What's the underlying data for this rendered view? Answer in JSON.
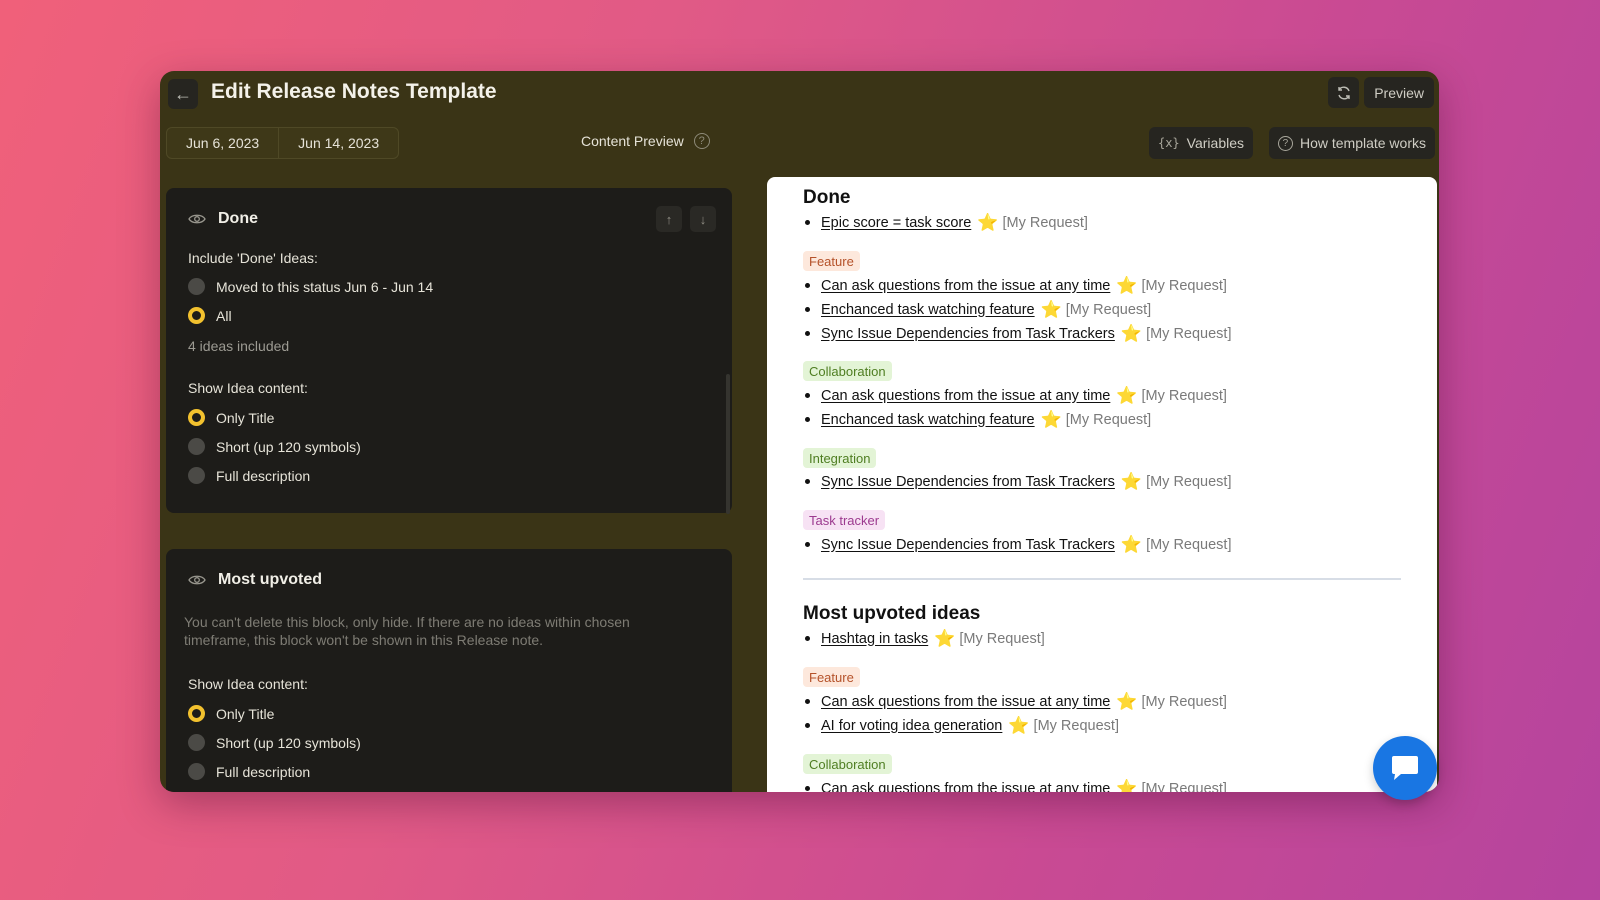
{
  "header": {
    "title": "Edit Release Notes Template",
    "back_icon": "←",
    "preview_label": "Preview"
  },
  "toolbar": {
    "date_start": "Jun 6, 2023",
    "date_end": "Jun 14, 2023",
    "content_preview_label": "Content Preview",
    "help_glyph": "?",
    "variables_glyph": "{x}",
    "variables_label": "Variables",
    "how_it_works_label": "How template works"
  },
  "done_card": {
    "title": "Done",
    "include_label": "Include 'Done' Ideas:",
    "include_options": [
      {
        "label": "Moved to this status Jun 6 - Jun 14",
        "selected": false
      },
      {
        "label": "All",
        "selected": true
      }
    ],
    "count_text": "4 ideas included",
    "content_label": "Show Idea content:",
    "content_options": [
      {
        "label": "Only Title",
        "selected": true
      },
      {
        "label": "Short (up 120 symbols)",
        "selected": false
      },
      {
        "label": "Full description",
        "selected": false
      }
    ],
    "up_glyph": "↑",
    "down_glyph": "↓"
  },
  "upvoted_card": {
    "title": "Most upvoted",
    "note": "You can't delete this block, only hide. If there are no ideas within chosen timeframe, this block won't be shown in this Release note.",
    "content_label": "Show Idea content:",
    "content_options": [
      {
        "label": "Only Title",
        "selected": true
      },
      {
        "label": "Short (up 120 symbols)",
        "selected": false
      },
      {
        "label": "Full description",
        "selected": false
      }
    ]
  },
  "preview": {
    "done_heading": "Done",
    "star": "⭐",
    "request": "[My Request]",
    "done_top": [
      "Epic score = task score"
    ],
    "done_feature_tag": "Feature",
    "done_feature": [
      "Can ask questions from the issue at any time",
      "Enchanced task watching feature",
      "Sync Issue Dependencies from Task Trackers"
    ],
    "done_collab_tag": "Collaboration",
    "done_collab": [
      "Can ask questions from the issue at any time",
      "Enchanced task watching feature"
    ],
    "done_integ_tag": "Integration",
    "done_integ": [
      "Sync Issue Dependencies from Task Trackers"
    ],
    "done_task_tag": "Task tracker",
    "done_task": [
      "Sync Issue Dependencies from Task Trackers"
    ],
    "upvoted_heading": "Most upvoted ideas",
    "up_top": [
      "Hashtag in tasks"
    ],
    "up_feature_tag": "Feature",
    "up_feature": [
      "Can ask questions from the issue at any time",
      "AI for voting idea generation"
    ],
    "up_collab_tag": "Collaboration",
    "up_collab": [
      "Can ask questions from the issue at any time"
    ]
  },
  "colors": {
    "accent_radio": "#f2c12e",
    "chat_button": "#1976e3",
    "window_bg": "#3a3416"
  }
}
